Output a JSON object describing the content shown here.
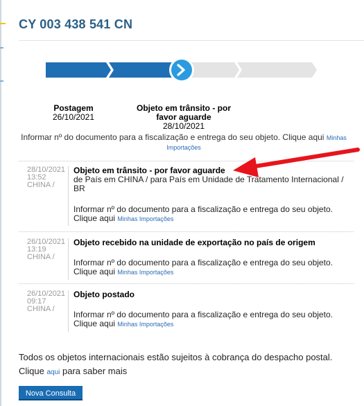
{
  "tracking_code": "CY 003 438 541 CN",
  "progress": {
    "steps_total": 4,
    "current_step": 2
  },
  "steps": [
    {
      "title": "Postagem",
      "date": "26/10/2021"
    },
    {
      "title": "Objeto em trânsito - por favor aguarde",
      "date": "28/10/2021"
    }
  ],
  "notice": {
    "text": "Informar nº do documento para a fiscalização e entrega do seu objeto. Clique aqui",
    "link": "Minhas Importações"
  },
  "events": [
    {
      "date": "28/10/2021",
      "time": "13:52",
      "location": "CHINA /",
      "title": "Objeto em trânsito - por favor aguarde",
      "detail": "de País em CHINA / para País em Unidade de Tratamento Internacional / BR",
      "info": "Informar nº do documento para a fiscalização e entrega do seu objeto. Clique aqui",
      "link": "Minhas Importações"
    },
    {
      "date": "26/10/2021",
      "time": "13:19",
      "location": "CHINA /",
      "title": "Objeto recebido na unidade de exportação no país de origem",
      "info": "Informar nº do documento para a fiscalização e entrega do seu objeto. Clique aqui",
      "link": "Minhas Importações"
    },
    {
      "date": "26/10/2021",
      "time": "09:17",
      "location": "CHINA /",
      "title": "Objeto postado",
      "info": "Informar nº do documento para a fiscalização e entrega do seu objeto. Clique aqui",
      "link": "Minhas Importações"
    }
  ],
  "footer": {
    "text_before": "Todos os objetos internacionais estão sujeitos à cobrança do despacho postal. Clique",
    "link": "aqui",
    "text_after": "para saber mais"
  },
  "button_label": "Nova Consulta",
  "colors": {
    "brand_blue": "#2b5f86",
    "progress_done": "#1f6fb5",
    "progress_todo": "#e4e4e4",
    "current_circle": "#2b9be0",
    "arrow": "#e8141c"
  }
}
